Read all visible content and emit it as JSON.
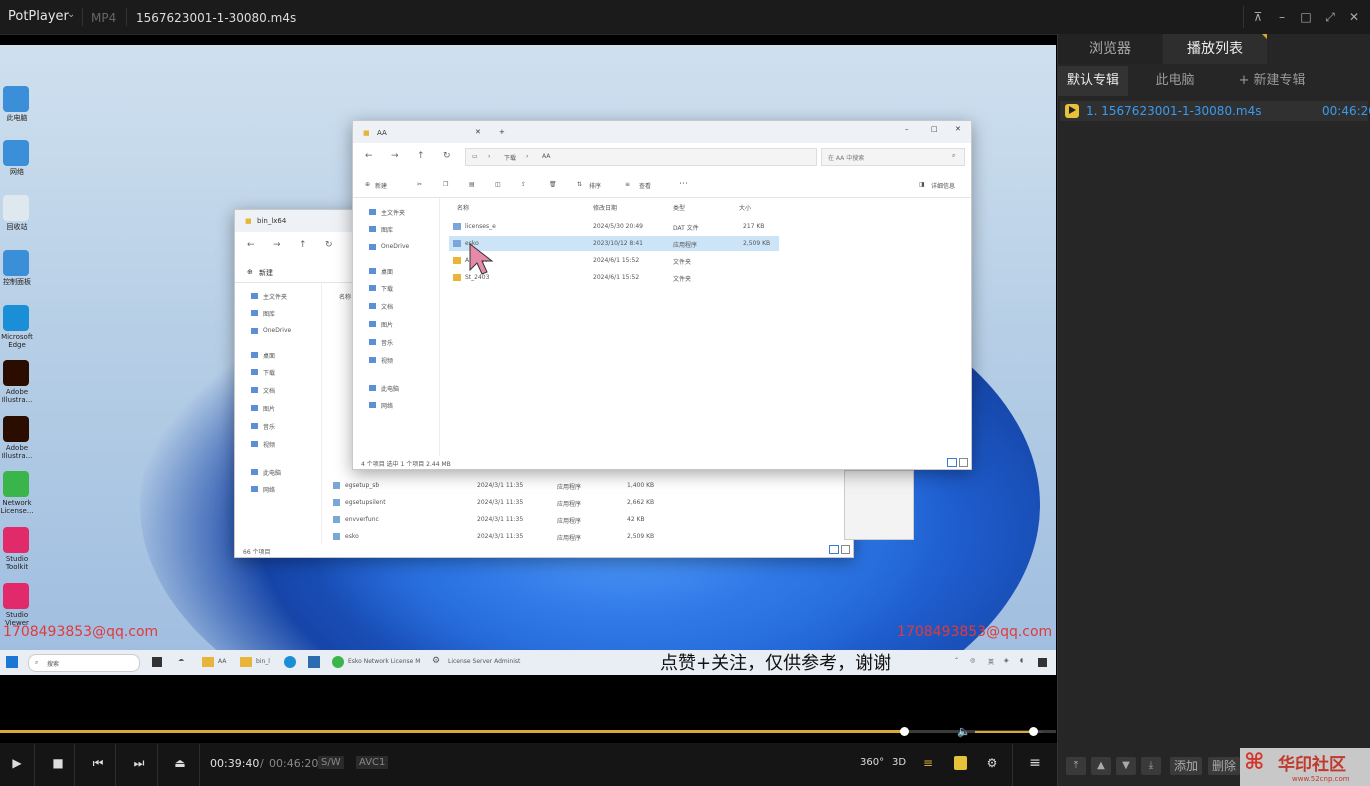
{
  "titlebar": {
    "app": "PotPlayer",
    "format": "MP4",
    "filename": "1567623001-1-30080.m4s"
  },
  "desktop": {
    "icons": [
      {
        "label": "此电脑",
        "color": "#3a8fd8"
      },
      {
        "label": "网络",
        "color": "#3a8fd8"
      },
      {
        "label": "回收站",
        "color": "#dfe7ef"
      },
      {
        "label": "控制面板",
        "color": "#3a8fd8"
      },
      {
        "label": "Microsoft Edge",
        "color": "#1a8fd8"
      },
      {
        "label": "Adobe Illustra...",
        "color": "#2b0d00"
      },
      {
        "label": "Adobe Illustra...",
        "color": "#2b0d00"
      },
      {
        "label": "Network License...",
        "color": "#39b54a"
      },
      {
        "label": "Studio Toolkit",
        "color": "#e02a6a"
      },
      {
        "label": "Studio Viewer",
        "color": "#e02a6a"
      }
    ],
    "watermark_left": "1708493853@qq.com",
    "watermark_right": "1708493853@qq.com",
    "subtitle": "点赞+关注，仅供参考，谢谢"
  },
  "explorer_front": {
    "tab": "AA",
    "path": [
      "下载",
      "AA"
    ],
    "search_placeholder": "在 AA 中搜索",
    "toolbar": {
      "new": "新建",
      "sort": "排序",
      "view": "查看",
      "details": "详细信息"
    },
    "nav": [
      "主文件夹",
      "图库",
      "OneDrive",
      "桌面",
      "下载",
      "文档",
      "图片",
      "音乐",
      "视频",
      "此电脑",
      "网络"
    ],
    "columns": [
      "名称",
      "修改日期",
      "类型",
      "大小"
    ],
    "rows": [
      {
        "name": "licenses_e",
        "date": "2024/5/30 20:49",
        "type": "DAT 文件",
        "size": "217 KB"
      },
      {
        "name": "esko",
        "date": "2023/10/12 8:41",
        "type": "应用程序",
        "size": "2,509 KB"
      },
      {
        "name": "Ai 2024",
        "date": "2024/6/1 15:52",
        "type": "文件夹",
        "size": ""
      },
      {
        "name": "St_2403",
        "date": "2024/6/1 15:52",
        "type": "文件夹",
        "size": ""
      }
    ],
    "status": "4 个项目    选中 1 个项目  2.44 MB"
  },
  "explorer_back": {
    "tab": "bin_lx64",
    "toolbar_new": "新建",
    "nav": [
      "主文件夹",
      "图库",
      "OneDrive",
      "桌面",
      "下载",
      "文档",
      "图片",
      "音乐",
      "视频",
      "此电脑",
      "网络"
    ],
    "column_name": "名称",
    "rows": [
      {
        "name": "egsetup_sb",
        "date": "2024/3/1 11:35",
        "type": "应用程序",
        "size": "1,400 KB"
      },
      {
        "name": "egsetupsilent",
        "date": "2024/3/1 11:35",
        "type": "应用程序",
        "size": "2,662 KB"
      },
      {
        "name": "envverfunc",
        "date": "2024/3/1 11:35",
        "type": "应用程序",
        "size": "42 KB"
      },
      {
        "name": "esko",
        "date": "2024/3/1 11:35",
        "type": "应用程序",
        "size": "2,509 KB"
      }
    ],
    "status": "66 个项目"
  },
  "taskbar": {
    "search": "搜索",
    "items": [
      "AA",
      "bin_l",
      "Esko Network License M",
      "License Server Administ"
    ],
    "tray_lang": "英"
  },
  "player": {
    "current": "00:39:40",
    "separator": "/",
    "total": "00:46:20",
    "sw": "S/W",
    "codec": "AVC1",
    "progress": 0.856,
    "volume": 0.85
  },
  "panel": {
    "tabs": [
      "浏览器",
      "播放列表"
    ],
    "subtabs": [
      "默认专辑",
      "此电脑",
      "+ 新建专辑"
    ],
    "items": [
      {
        "title": "1. 1567623001-1-30080.m4s",
        "duration": "00:46:20"
      }
    ],
    "buttons": {
      "add": "添加",
      "delete": "删除"
    }
  },
  "badge": "华印社区",
  "badge_url": "www.52cnp.com"
}
